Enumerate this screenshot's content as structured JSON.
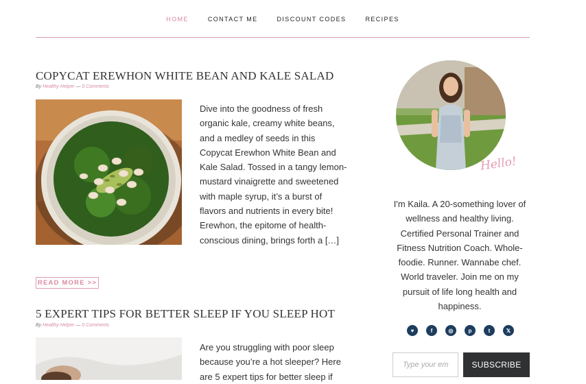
{
  "nav": {
    "items": [
      {
        "label": "HOME"
      },
      {
        "label": "CONTACT ME"
      },
      {
        "label": "DISCOUNT CODES"
      },
      {
        "label": "RECIPES"
      }
    ]
  },
  "posts": [
    {
      "title": "COPYCAT EREWHON WHITE BEAN AND KALE SALAD",
      "by": "By",
      "author": "Healthy Helper",
      "dash": "—",
      "comments": "0 Comments",
      "excerpt": "Dive into the goodness of fresh organic kale, creamy white beans, and a medley of seeds in this Copycat Erewhon White Bean and Kale Salad. Tossed in a tangy lemon-mustard vinaigrette and sweetened with maple syrup, it’s a burst of flavors and nutrients in every bite! Erewhon, the epitome of health-conscious dining, brings forth a […]",
      "read_more": "READ MORE >>"
    },
    {
      "title": "5 EXPERT TIPS FOR BETTER SLEEP IF YOU SLEEP HOT",
      "by": "By",
      "author": "Healthy Helper",
      "dash": "—",
      "comments": "0 Comments",
      "excerpt": "Are you struggling with poor sleep because you’re a hot sleeper? Here are 5 expert tips for better sleep if"
    }
  ],
  "sidebar": {
    "hello": "Hello!",
    "bio": "I'm Kaila. A 20-something lover of wellness and healthy living. Certified Personal Trainer and Fitness Nutrition Coach. Whole-foodie. Runner. Wannabe chef. World traveler. Join me on my pursuit of life long health and happiness.",
    "socials": [
      {
        "icon": "heart-icon",
        "glyph": "♥"
      },
      {
        "icon": "facebook-icon",
        "glyph": "f"
      },
      {
        "icon": "instagram-icon",
        "glyph": "◎"
      },
      {
        "icon": "pinterest-icon",
        "glyph": "p"
      },
      {
        "icon": "tumblr-icon",
        "glyph": "t"
      },
      {
        "icon": "x-icon",
        "glyph": "𝕏"
      }
    ],
    "email_placeholder": "Type your email...",
    "subscribe_label": "SUBSCRIBE"
  },
  "colors": {
    "accent_pink": "#d88ba0",
    "social_blue": "#1d3d5e",
    "button_dark": "#303133"
  }
}
